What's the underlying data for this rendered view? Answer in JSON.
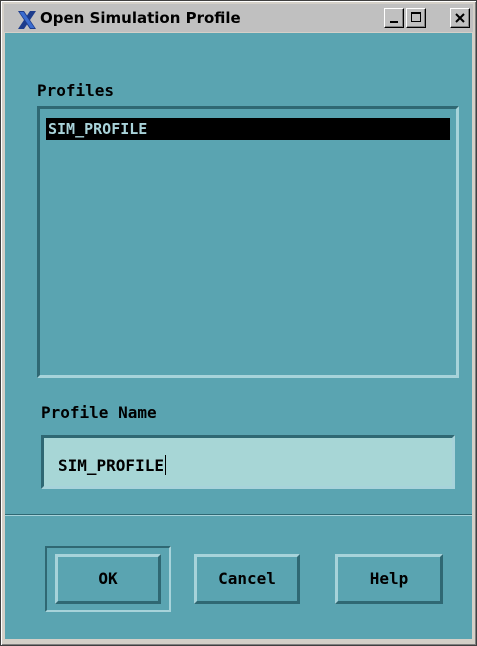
{
  "window": {
    "title": "Open Simulation Profile"
  },
  "icons": {
    "app": "x-window-icon",
    "minimize": "minimize-icon",
    "maximize": "maximize-icon",
    "close": "close-icon"
  },
  "profiles": {
    "label": "Profiles",
    "items": [
      "SIM_PROFILE"
    ],
    "selected_index": 0
  },
  "profile_name": {
    "label": "Profile Name",
    "value": "SIM_PROFILE"
  },
  "buttons": {
    "ok": "OK",
    "cancel": "Cancel",
    "help": "Help"
  },
  "colors": {
    "panel": "#5aa4b1",
    "field": "#a7d6d6",
    "selection": "#000000",
    "selection_text": "#a9d3da"
  }
}
